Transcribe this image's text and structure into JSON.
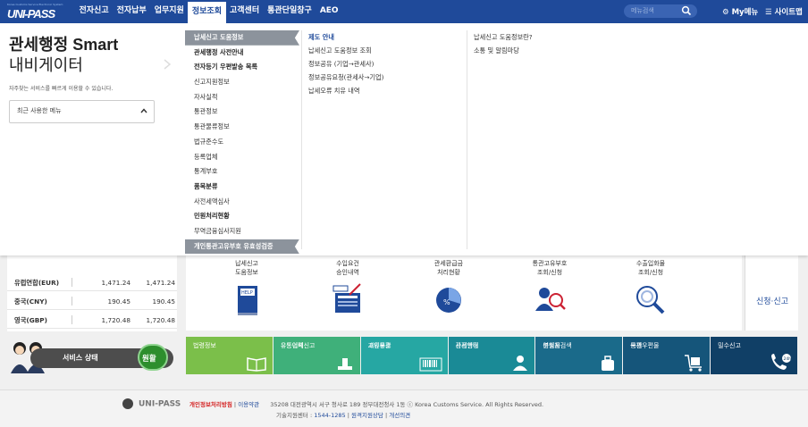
{
  "header": {
    "logo_small": "Korea Customs Service Electronic System",
    "logo": "UNI-PASS",
    "nav": [
      "전자신고",
      "전자납부",
      "업무지원",
      "정보조회",
      "고객센터",
      "통관단일창구",
      "AEO"
    ],
    "active_nav": "정보조회",
    "search_placeholder": "메뉴검색",
    "mymenu": "My메뉴",
    "sitemap": "사이트맵"
  },
  "mega": {
    "title_line1": "관세행정 Smart",
    "title_line2": "내비게이터",
    "desc": "자주찾는 서비스를 빠르게 이용할 수 있습니다.",
    "recent_label": "최근 사용한 메뉴",
    "col1": [
      {
        "label": "납세신고 도움정보",
        "style": "hl"
      },
      {
        "label": "관세행정 사전안내",
        "style": "bold"
      },
      {
        "label": "전자등기 우편발송 목록",
        "style": "bold"
      },
      {
        "label": "신고지원정보",
        "style": ""
      },
      {
        "label": "자사실적",
        "style": ""
      },
      {
        "label": "통관정보",
        "style": ""
      },
      {
        "label": "통관물류정보",
        "style": ""
      },
      {
        "label": "법규준수도",
        "style": ""
      },
      {
        "label": "등록업체",
        "style": ""
      },
      {
        "label": "통계부호",
        "style": ""
      },
      {
        "label": "품목분류",
        "style": "bold"
      },
      {
        "label": "사전세액심사",
        "style": ""
      },
      {
        "label": "민원처리현황",
        "style": "bold"
      },
      {
        "label": "무역금융심사지원",
        "style": ""
      },
      {
        "label": "개인통관고유부호 유효성검증",
        "style": "hl"
      }
    ],
    "col2": [
      "제도 안내",
      "납세신고 도움정보 조회",
      "정보공유 (기업→관세사)",
      "정보공유요청(관세사→기업)",
      "납세오류 치유 내역"
    ],
    "col3": [
      "납세신고 도움정보란?",
      "소통 및 알림마당"
    ]
  },
  "exchange": [
    {
      "name": "유럽연합(EUR)",
      "v1": "1,471.24",
      "v2": "1,471.24"
    },
    {
      "name": "중국(CNY)",
      "v1": "190.45",
      "v2": "190.45"
    },
    {
      "name": "영국(GBP)",
      "v1": "1,720.48",
      "v2": "1,720.48"
    }
  ],
  "services": [
    {
      "label": "납세신고\n도움정보"
    },
    {
      "label": "수입요건\n승인내역"
    },
    {
      "label": "관세환급금\n처리현황"
    },
    {
      "label": "통관고유부호\n조회/신청"
    },
    {
      "label": "수출입화물\n조회/신청"
    }
  ],
  "apply_label": "신청·신고",
  "status": {
    "label": "서비스 상태",
    "value": "원활"
  },
  "tiles": [
    {
      "label": "법령정보",
      "color": "#7bbf4a"
    },
    {
      "label": "유통업체\n유통이력신고",
      "color": "#3fb07a"
    },
    {
      "label": "개인통관\n고유부호",
      "color": "#26a7a3"
    },
    {
      "label": "관세행정\n사전안내",
      "color": "#1a8a96"
    },
    {
      "label": "여행자\n분실물검색",
      "color": "#1a6a8a"
    },
    {
      "label": "국제우편물\n통관",
      "color": "#15557a"
    },
    {
      "label": "밀수신고",
      "color": "#103f66"
    }
  ],
  "footer": {
    "brand": "UNI-PASS",
    "privacy": "개인정보처리방침",
    "terms": "이용약관",
    "address": "35208 대전광역시 서구 청사로 189 정부대전청사 1동 ⓒ Korea Customs Service. All Rights Reserved.",
    "support_prefix": "기술지원센터 :",
    "phone": "1544-1285",
    "remote": "원격지원상담",
    "improve": "개선의견"
  }
}
